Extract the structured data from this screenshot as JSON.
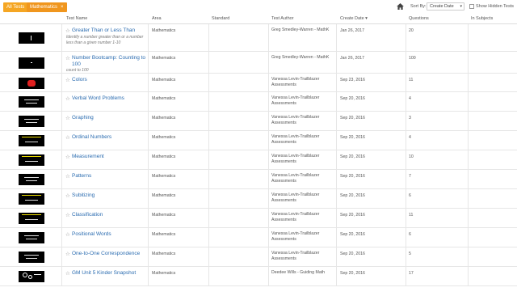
{
  "filters": {
    "all_tests": "All Tests",
    "mathematics": "Mathematics",
    "remove": "×"
  },
  "toolbar": {
    "sort_label": "Sort By:",
    "sort_value": "Create Date",
    "show_hidden": "Show Hidden Tests"
  },
  "columns": {
    "test_name": "Test Name",
    "area": "Area",
    "standard": "Standard",
    "test_author": "Test Author",
    "create_date": "Create Date ▾",
    "questions": "Questions",
    "in_subjects": "In Subjects"
  },
  "rows": [
    {
      "title": "Greater Than or Less Than",
      "desc": "Identify a number greater than or a number less than a given number 1-10",
      "area": "Mathematics",
      "author": "Greg Smedley-Warren - MathK",
      "date": "Jan 26, 2017",
      "questions": "20",
      "thumb": "line"
    },
    {
      "title": "Number Bootcamp: Counting to 100",
      "desc": "count to 100",
      "area": "Mathematics",
      "author": "Greg Smedley-Warren - MathK",
      "date": "Jan 26, 2017",
      "questions": "100",
      "thumb": "dot"
    },
    {
      "title": "Colors",
      "desc": "",
      "area": "Mathematics",
      "author": "Vanessa Levin-Trailblazer Assessments",
      "date": "Sep 23, 2016",
      "questions": "11",
      "thumb": "red"
    },
    {
      "title": "Verbal Word Problems",
      "desc": "",
      "area": "Mathematics",
      "author": "Vanessa Levin-Trailblazer Assessments",
      "date": "Sep 20, 2016",
      "questions": "4",
      "thumb": "text"
    },
    {
      "title": "Graphing",
      "desc": "",
      "area": "Mathematics",
      "author": "Vanessa Levin-Trailblazer Assessments",
      "date": "Sep 20, 2016",
      "questions": "3",
      "thumb": "text"
    },
    {
      "title": "Ordinal Numbers",
      "desc": "",
      "area": "Mathematics",
      "author": "Vanessa Levin-Trailblazer Assessments",
      "date": "Sep 20, 2016",
      "questions": "4",
      "thumb": "yellow"
    },
    {
      "title": "Measurement",
      "desc": "",
      "area": "Mathematics",
      "author": "Vanessa Levin-Trailblazer Assessments",
      "date": "Sep 20, 2016",
      "questions": "10",
      "thumb": "yellow"
    },
    {
      "title": "Patterns",
      "desc": "",
      "area": "Mathematics",
      "author": "Vanessa Levin-Trailblazer Assessments",
      "date": "Sep 20, 2016",
      "questions": "7",
      "thumb": "text"
    },
    {
      "title": "Subitizing",
      "desc": "",
      "area": "Mathematics",
      "author": "Vanessa Levin-Trailblazer Assessments",
      "date": "Sep 20, 2016",
      "questions": "6",
      "thumb": "yellow"
    },
    {
      "title": "Classification",
      "desc": "",
      "area": "Mathematics",
      "author": "Vanessa Levin-Trailblazer Assessments",
      "date": "Sep 20, 2016",
      "questions": "11",
      "thumb": "yellow"
    },
    {
      "title": "Positional Words",
      "desc": "",
      "area": "Mathematics",
      "author": "Vanessa Levin-Trailblazer Assessments",
      "date": "Sep 20, 2016",
      "questions": "6",
      "thumb": "text"
    },
    {
      "title": "One-to-One Correspondence",
      "desc": "",
      "area": "Mathematics",
      "author": "Vanessa Levin-Trailblazer Assessments",
      "date": "Sep 20, 2016",
      "questions": "5",
      "thumb": "text"
    },
    {
      "title": "GM Unit 5 Kinder Snapshot",
      "desc": "",
      "area": "Mathematics",
      "author": "Deedee Wills - Guiding Math",
      "date": "Sep 20, 2016",
      "questions": "17",
      "thumb": "circles"
    }
  ]
}
